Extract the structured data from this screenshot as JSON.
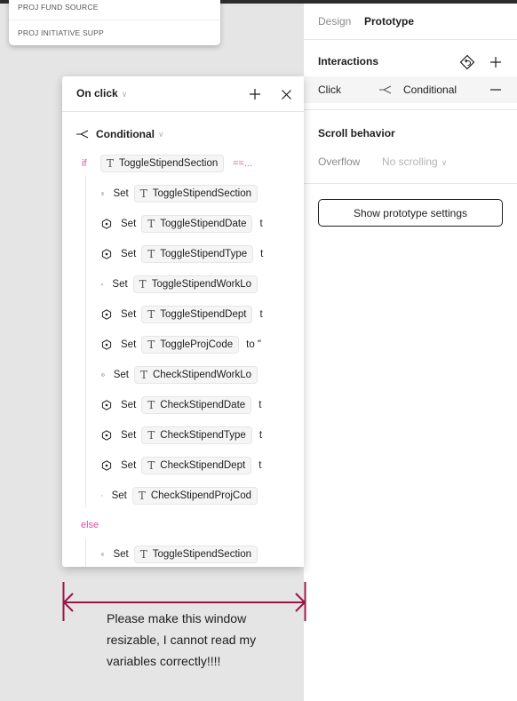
{
  "layer_menu": {
    "items": [
      "PROJ FUND SOURCE",
      "PROJ INITIATIVE SUPP"
    ]
  },
  "properties_panel": {
    "tabs": [
      {
        "label": "Design",
        "active": false
      },
      {
        "label": "Prototype",
        "active": true
      }
    ],
    "interactions": {
      "title": "Interactions",
      "rows": [
        {
          "trigger": "Click",
          "action": "Conditional",
          "icon": "conditional-icon"
        }
      ]
    },
    "scroll_behavior": {
      "title": "Scroll behavior",
      "overflow_label": "Overflow",
      "overflow_value": "No scrolling"
    },
    "show_settings_label": "Show prototype settings"
  },
  "interaction_popup": {
    "trigger_label": "On click",
    "action_label": "Conditional",
    "if_keyword": "if",
    "else_keyword": "else",
    "condition": {
      "variable": "ToggleStipendSection",
      "operator": "==..."
    },
    "if_actions": [
      {
        "verb": "Set",
        "variable": "ToggleStipendSection",
        "suffix": ""
      },
      {
        "verb": "Set",
        "variable": "ToggleStipendDate",
        "suffix": "t"
      },
      {
        "verb": "Set",
        "variable": "ToggleStipendType",
        "suffix": "t"
      },
      {
        "verb": "Set",
        "variable": "ToggleStipendWorkLo",
        "suffix": ""
      },
      {
        "verb": "Set",
        "variable": "ToggleStipendDept",
        "suffix": "t"
      },
      {
        "verb": "Set",
        "variable": "ToggleProjCode",
        "suffix": "to \""
      },
      {
        "verb": "Set",
        "variable": "CheckStipendWorkLo",
        "suffix": ""
      },
      {
        "verb": "Set",
        "variable": "CheckStipendDate",
        "suffix": "t"
      },
      {
        "verb": "Set",
        "variable": "CheckStipendType",
        "suffix": "t"
      },
      {
        "verb": "Set",
        "variable": "CheckStipendDept",
        "suffix": "t"
      },
      {
        "verb": "Set",
        "variable": "CheckStipendProjCod",
        "suffix": ""
      }
    ],
    "else_actions": [
      {
        "verb": "Set",
        "variable": "ToggleStipendSection",
        "suffix": ""
      }
    ]
  },
  "annotation": {
    "text": "Please make this window resizable, I cannot read my variables correctly!!!!",
    "color": "#9b1446"
  },
  "colors": {
    "keyword": "#e14ba4",
    "canvas": "#e5e5e5",
    "annotation_arrow": "#9b1446"
  }
}
